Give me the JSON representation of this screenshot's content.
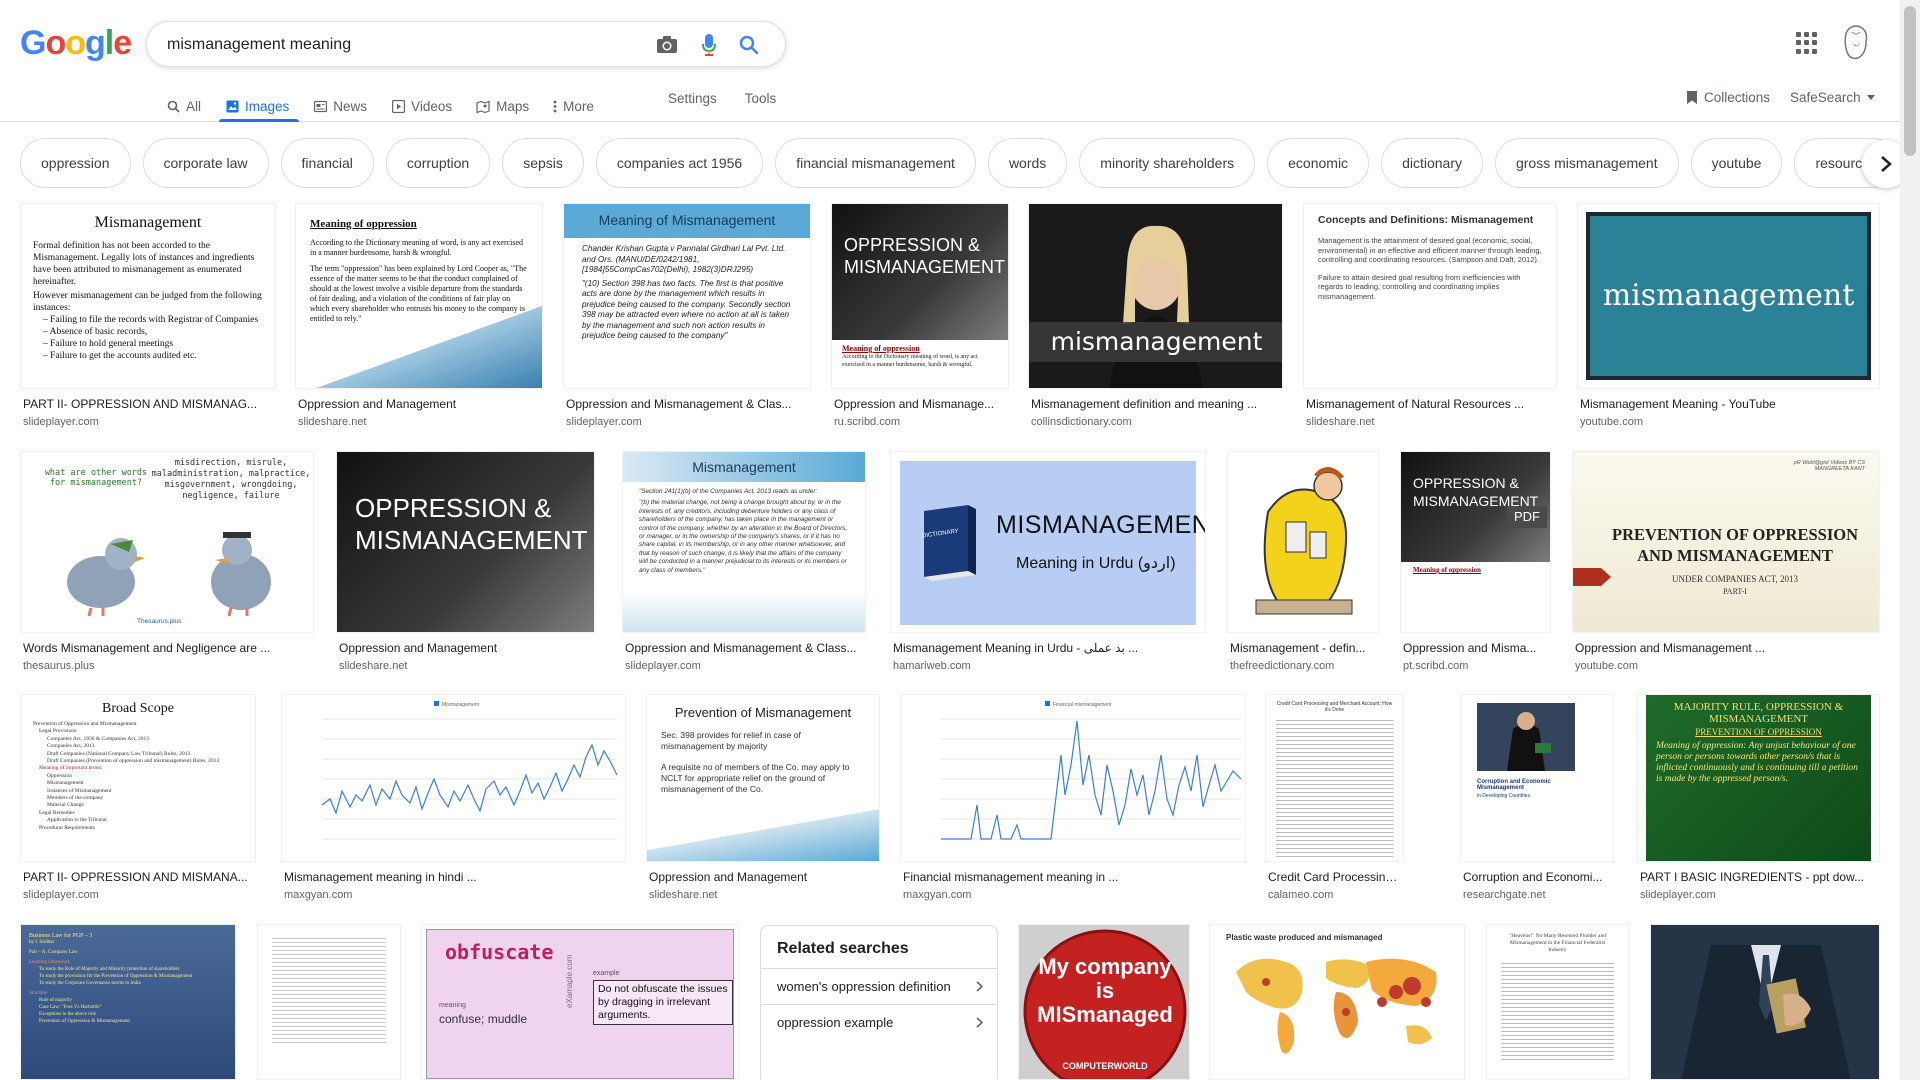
{
  "search": {
    "query": "mismanagement meaning"
  },
  "logo": [
    "G",
    "o",
    "o",
    "g",
    "l",
    "e"
  ],
  "tabs": [
    {
      "label": "All",
      "icon": "search-icon"
    },
    {
      "label": "Images",
      "icon": "image-icon",
      "active": true
    },
    {
      "label": "News",
      "icon": "news-icon"
    },
    {
      "label": "Videos",
      "icon": "video-icon"
    },
    {
      "label": "Maps",
      "icon": "map-icon"
    },
    {
      "label": "More",
      "icon": "more-icon"
    }
  ],
  "tools": {
    "settings": "Settings",
    "tools": "Tools"
  },
  "right": {
    "collections": "Collections",
    "safesearch": "SafeSearch"
  },
  "chips": [
    "oppression",
    "corporate law",
    "financial",
    "corruption",
    "sepsis",
    "companies act 1956",
    "financial mismanagement",
    "words",
    "minority shareholders",
    "economic",
    "dictionary",
    "gross mismanagement",
    "youtube",
    "resources"
  ],
  "rows": [
    [
      {
        "caption": "PART II- OPPRESSION AND MISMANAG...",
        "source": "slideplayer.com",
        "thumb_title": "Mismanagement",
        "thumb_lines": [
          "Formal definition has not been accorded to the Mismanagement. Legally lots of instances and ingredients have been attributed to mismanagement as enumerated hereinafter.",
          "However mismanagement can be judged from the following instances:",
          "– Failing to file the records with Registrar of Companies",
          "– Absence of basic records,",
          "– Failure to hold general meetings",
          "– Failure to get the accounts audited etc."
        ]
      },
      {
        "caption": "Oppression and Management",
        "source": "slideshare.net",
        "thumb_title": "Meaning of oppression",
        "thumb_lines": [
          "According to the Dictionary meaning of word, is any act exercised in a manner burdensome, harsh & wrongful.",
          "The term \"oppression\" has been explained by Lord Cooper as, \"The essence of the matter seems to be that the conduct complained of should at the lowest involve a visible departure from the standards of fair dealing, and a violation of the conditions of fair play on which every shareholder who entrusts his money to the company is entitled to rely.\""
        ]
      },
      {
        "caption": "Oppression and Mismanagement & Clas...",
        "source": "slideplayer.com",
        "thumb_title": "Meaning of Mismanagement",
        "thumb_lines": [
          "Chander Krishan Gupta v Pannalal Girdhari Lal Pvt. Ltd. and Ors. (MANU/DE/0242/1981, [1984]55CompCas702(Delhi), 1982(3)DRJ295)",
          "\"(10) Section 398 has two facts. The first is that positive acts are done by the management which results in prejudice being caused to the company. Secondly section 398 may be attracted even where no action at all is taken by the management and such non action results in prejudice being caused to the company\""
        ]
      },
      {
        "caption": "Oppression and Mismanage...",
        "source": "ru.scribd.com",
        "thumb_title": "OPPRESSION & MISMANAGEMENT",
        "thumb_sub": "Meaning of oppression",
        "thumb_lines": [
          "According to the Dictionary meaning of word, is any act exercised in a manner burdensome, harsh & wrongful."
        ]
      },
      {
        "caption": "Mismanagement definition and meaning ...",
        "source": "collinsdictionary.com",
        "thumb_title": "mismanagement"
      },
      {
        "caption": "Mismanagement of Natural Resources ...",
        "source": "slideshare.net",
        "thumb_title": "Concepts and Definitions: Mismanagement",
        "thumb_lines": [
          "Management is the attainment of desired goal (economic, social, environmental) in an effective and efficient manner through leading, controlling and coordinating resources. (Sampson and Daft, 2012).",
          "Failure to attain desired goal resulting from inefficiencies with regards to leading, controlling and coordinating implies mismanagement."
        ]
      },
      {
        "caption": "Mismanagement Meaning - YouTube",
        "source": "youtube.com",
        "thumb_title": "mismanagement"
      }
    ],
    [
      {
        "caption": "Words Mismanagement and Negligence are ...",
        "source": "thesaurus.plus",
        "thumb_title": "what are other words for mismanagement?",
        "thumb_lines": [
          "misdirection, misrule, maladministration, malpractice, misgovernment, wrongdoing, negligence, failure"
        ],
        "thumb_sub": "Thesaurus.plus"
      },
      {
        "caption": "Oppression and Management",
        "source": "slideshare.net",
        "thumb_title": "OPPRESSION & MISMANAGEMENT"
      },
      {
        "caption": "Oppression and Mismanagement & Class...",
        "source": "slideplayer.com",
        "thumb_title": "Mismanagement",
        "thumb_lines": [
          "\"Section 241(1)(b) of the Companies Act, 2013 reads as under:",
          "\"(b) the material change, not being a change brought about by, or in the interests of, any creditors, including debenture holders or any class of shareholders of the company, has taken place in the management or control of the company, whether by an alteration in the Board of Directors, or manager, or in the ownership of the company's shares, or if it has no share capital, in its membership, or in any other manner whatsoever, and that by reason of such change, it is likely that the affairs of the company will be conducted in a manner prejudicial to its interests or its members or any class of members.\""
        ]
      },
      {
        "caption": "Mismanagement Meaning in Urdu - بد عملی ...",
        "source": "hamariweb.com",
        "thumb_title": "MISMANAGEMENT",
        "thumb_sub": "Meaning in Urdu (اردو)",
        "thumb_book": "DICTIONARY"
      },
      {
        "caption": "Mismanagement - defin...",
        "source": "thefreedictionary.com"
      },
      {
        "caption": "Oppression and Misma...",
        "source": "pt.scribd.com",
        "thumb_title": "OPPRESSION & MISMANAGEMENT",
        "thumb_badge": "PDF",
        "thumb_sub": "Meaning of oppression"
      },
      {
        "caption": "Oppression and Mismanagement ...",
        "source": "youtube.com",
        "thumb_title": "PREVENTION OF OPPRESSION AND MISMANAGEMENT",
        "thumb_sub": "UNDER COMPANIES ACT, 2013",
        "thumb_part": "PART-I",
        "thumb_corner": "pR Webl@gist Videos BY CS MANGREETA KANT"
      }
    ],
    [
      {
        "caption": "PART II- OPPRESSION AND MISMANA...",
        "source": "slideplayer.com",
        "thumb_title": "Broad Scope",
        "thumb_lines": [
          "Prevention of Oppression and Mismanagement",
          "Legal Provisions:",
          "Companies Act, 1956 & Companies Act, 2013",
          "Companies Act, 2013",
          "Draft Companies (National Company Law Tribunal) Rules, 2013",
          "Draft Companies (Prevention of oppression and mismanagement) Rules, 2013",
          "Meaning of important terms:",
          "Oppression",
          "Mismanagement",
          "Instances of Mismanagement",
          "Members of the company",
          "Material Change",
          "Legal Remedies",
          "Application to the Tribunal",
          "Procedural Requirements"
        ]
      },
      {
        "caption": "Mismanagement meaning in hindi ...",
        "source": "maxgyan.com",
        "thumb_legend": "Mismanagement"
      },
      {
        "caption": "Oppression and Management",
        "source": "slideshare.net",
        "thumb_title": "Prevention of Mismanagement",
        "thumb_lines": [
          "Sec. 398 provides for relief in case of mismanagement by majority",
          "A requisite no of members of the Co. may apply to NCLT for appropriate relief on the ground of mismanagement of the Co."
        ]
      },
      {
        "caption": "Financial mismanagement meaning in ...",
        "source": "maxgyan.com",
        "thumb_legend": "Financial mismanagement"
      },
      {
        "caption": "Credit Card Processing and...",
        "source": "calameo.com",
        "thumb_title": "Credit Card Processing and Merchant Account: How it's Done"
      },
      {
        "caption": "Corruption and Economi...",
        "source": "researchgate.net",
        "thumb_title": "Corruption and Economic Mismanagement",
        "thumb_sub": "in Developing Countries"
      },
      {
        "caption": "PART I BASIC INGREDIENTS - ppt dow...",
        "source": "slideplayer.com",
        "thumb_title": "MAJORITY RULE, OPPRESSION & MISMANAGEMENT",
        "thumb_sub": "PREVENTION OF OPPRESSION",
        "thumb_lines": [
          "Meaning of oppression: Any unjust behaviour of one person or persons towards other person/s that is inflicted continuously and is continuing till a petition is made by the oppressed person/s."
        ]
      }
    ],
    [
      {
        "thumb_title": "Business Law for PGP – 3",
        "thumb_lines": [
          "by I. Sridhar",
          "Part – A: Company Law",
          "Learning Objectives",
          "To study the Rule of Majority and Minority protection of shareholders",
          "To study the provisions for the Prevention of Oppression & Mismanagement",
          "To study the Corporate Governance norms in India",
          "Structure",
          "Rule of majority",
          "Case Law: \"Foss Vs Harbottle\"",
          "Exceptions to the above rule",
          "Prevention of Oppression & Mismanagement"
        ]
      },
      {
        "thumb_title": ""
      },
      {
        "thumb_title": "obfuscate",
        "thumb_def": "Do not obfuscate the issues by dragging in irrelevant arguments.",
        "thumb_meaning": "confuse; muddle",
        "thumb_lbl_meaning": "meaning",
        "thumb_lbl_example": "example",
        "thumb_brand": "eXamaple.com"
      },
      {
        "thumb_title": "My company is MISmanaged",
        "thumb_sub": "COMPUTERWORLD"
      },
      {
        "thumb_title": "Plastic waste produced and mismanaged"
      },
      {
        "thumb_title": "\"Heavens!\" No Many Resented Plunder and Mismanagement in the Financial Federalist Industry"
      },
      {
        "thumb_title": ""
      }
    ]
  ],
  "related": {
    "title": "Related searches",
    "items": [
      "women's oppression definition",
      "oppression example"
    ]
  },
  "colors": {
    "google_blue": "#4285F4",
    "google_red": "#EA4335",
    "google_yellow": "#FBBC05",
    "google_green": "#34A853",
    "accent": "#1a73e8"
  }
}
